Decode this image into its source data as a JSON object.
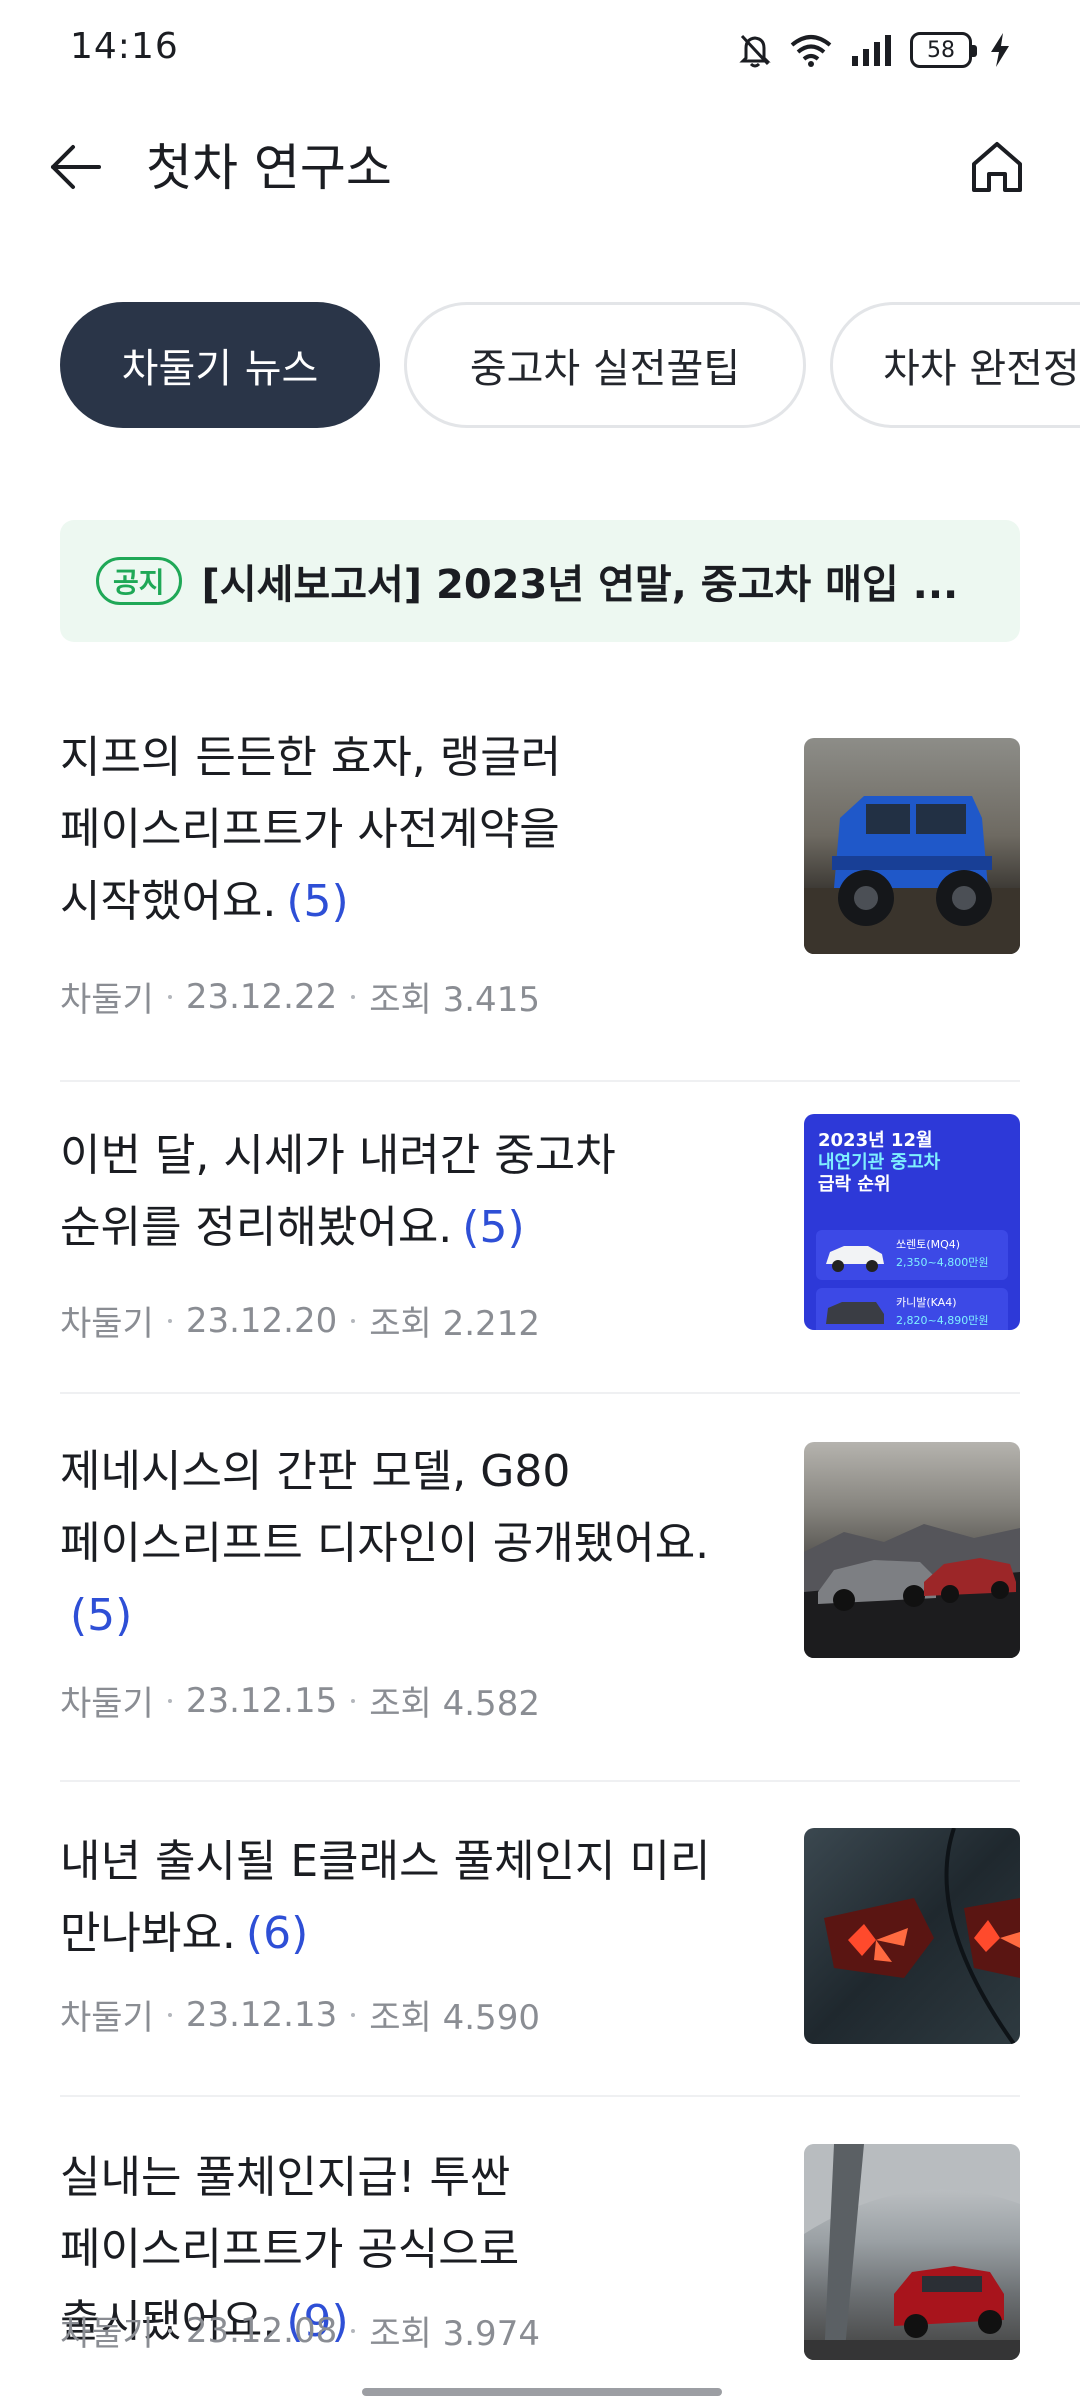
{
  "status_bar": {
    "time": "14:16",
    "battery_level": "58",
    "icons": [
      "mute-bell-icon",
      "wifi-icon",
      "signal-icon",
      "battery-icon",
      "charging-bolt-icon"
    ]
  },
  "header": {
    "title": "첫차 연구소",
    "back_icon": "arrow-left-icon",
    "home_icon": "home-icon"
  },
  "tabs": [
    {
      "label": "차둘기 뉴스",
      "active": true
    },
    {
      "label": "중고차 실전꿀팁",
      "active": false
    },
    {
      "label": "차차 완전정",
      "active": false
    }
  ],
  "notice": {
    "badge": "공지",
    "text": "[시세보고서] 2023년 연말, 중고차 매입 ..."
  },
  "articles": [
    {
      "title": "지프의 든든한 효자, 랭글러 페이스리프트가 사전계약을 시작했어요.",
      "comments": "(5)",
      "author": "차둘기",
      "date": "23.12.22",
      "views": "조회 3.415"
    },
    {
      "title": "이번 달, 시세가 내려간 중고차 순위를 정리해봤어요.",
      "comments": "(5)",
      "author": "차둘기",
      "date": "23.12.20",
      "views": "조회 2.212",
      "thumb_text": {
        "line1": "2023년 12월",
        "line2": "내연기관 중고차",
        "line3": "급락 순위",
        "item1": "쏘렌토(MQ4)",
        "item1_price": "2,350~4,800만원",
        "item2": "카니발(KA4)",
        "item2_price": "2,820~4,890만원"
      }
    },
    {
      "title": "제네시스의 간판 모델, G80 페이스리프트 디자인이 공개됐어요.",
      "comments": "(5)",
      "author": "차둘기",
      "date": "23.12.15",
      "views": "조회 4.582"
    },
    {
      "title": "내년 출시될 E클래스 풀체인지 미리 만나봐요.",
      "comments": "(6)",
      "author": "차둘기",
      "date": "23.12.13",
      "views": "조회 4.590"
    },
    {
      "title": "실내는 풀체인지급! 투싼 페이스리프트가 공식으로 출시됐어요.",
      "comments": "(9)",
      "author": "차둘기",
      "date": "23.12.08",
      "views": "조회 3.974"
    }
  ],
  "colors": {
    "active_tab": "#2a3548",
    "notice_bg": "#edf8f1",
    "notice_badge": "#1fa857",
    "comment_count": "#2e4fd6",
    "meta_text": "#8a8d93"
  }
}
